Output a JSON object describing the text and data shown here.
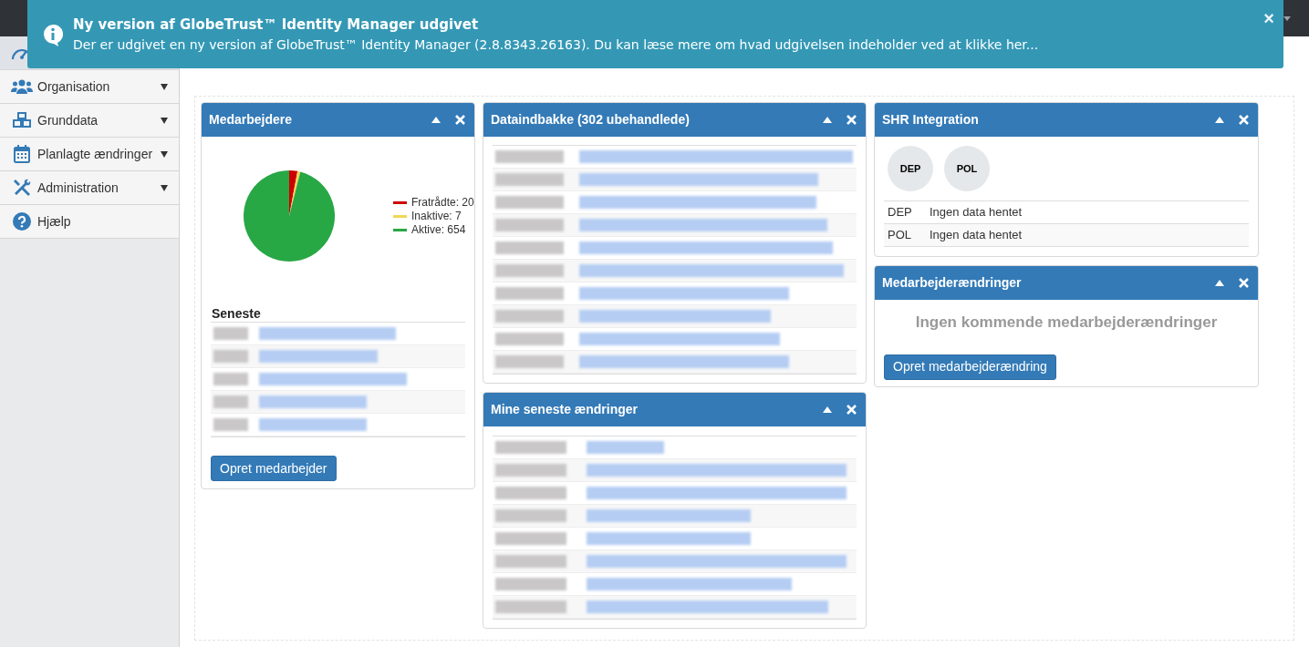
{
  "notification": {
    "title": "Ny version af GlobeTrust™ Identity Manager udgivet",
    "message": "Der er udgivet en ny version af GlobeTrust™ Identity Manager (2.8.8343.26163). Du kan læse mere om hvad udgivelsen indeholder ved at klikke her...",
    "close": "×"
  },
  "sidebar": {
    "items": [
      {
        "kind": "dashboard",
        "selected": true,
        "expandable": false
      },
      {
        "kind": "people",
        "label": "Organisation",
        "selected": false,
        "expandable": true
      },
      {
        "kind": "cubes",
        "label": "Grunddata",
        "selected": false,
        "expandable": true
      },
      {
        "kind": "calendar",
        "label": "Planlagte ændringer",
        "selected": false,
        "expandable": true
      },
      {
        "kind": "tools",
        "label": "Administration",
        "selected": false,
        "expandable": true
      },
      {
        "kind": "help",
        "label": "Hjælp",
        "selected": false,
        "expandable": false
      }
    ]
  },
  "panels": {
    "medarbejdere": {
      "title": "Medarbejdere",
      "chart_data": {
        "type": "pie",
        "categories": [
          "Fratrådte: 20",
          "Inaktive: 7",
          "Aktive: 654"
        ],
        "values": [
          20,
          7,
          654
        ]
      },
      "legend": [
        {
          "color": "#cc0000"
        },
        {
          "color": "#f1d653"
        },
        {
          "color": "#28a745"
        }
      ],
      "recent_title": "Seneste",
      "recent_rows": [
        {
          "kind": "redacted"
        },
        {
          "kind": "redacted"
        },
        {
          "kind": "redacted"
        },
        {
          "kind": "redacted"
        },
        {
          "kind": "redacted"
        }
      ],
      "button": "Opret medarbejder"
    },
    "inbox": {
      "title": "Dataindbakke (302 ubehandlede)",
      "rows": [
        {
          "kind": "redacted"
        },
        {
          "kind": "redacted"
        },
        {
          "kind": "redacted"
        },
        {
          "kind": "redacted"
        },
        {
          "kind": "redacted"
        },
        {
          "kind": "redacted"
        },
        {
          "kind": "redacted"
        },
        {
          "kind": "redacted"
        },
        {
          "kind": "redacted"
        },
        {
          "kind": "redacted"
        }
      ]
    },
    "changes": {
      "title": "Mine seneste ændringer",
      "rows": [
        {
          "kind": "redacted"
        },
        {
          "kind": "redacted"
        },
        {
          "kind": "redacted"
        },
        {
          "kind": "redacted"
        },
        {
          "kind": "redacted"
        },
        {
          "kind": "redacted"
        },
        {
          "kind": "redacted"
        },
        {
          "kind": "redacted"
        }
      ]
    },
    "shr": {
      "title": "SHR Integration",
      "badges": [
        "DEP",
        "POL"
      ],
      "rows": [
        {
          "code": "DEP",
          "status": "Ingen data hentet"
        },
        {
          "code": "POL",
          "status": "Ingen data hentet"
        }
      ]
    },
    "employee_changes": {
      "title": "Medarbejderændringer",
      "empty_message": "Ingen kommende medarbejderændringer",
      "button": "Opret medarbejderændring"
    }
  }
}
